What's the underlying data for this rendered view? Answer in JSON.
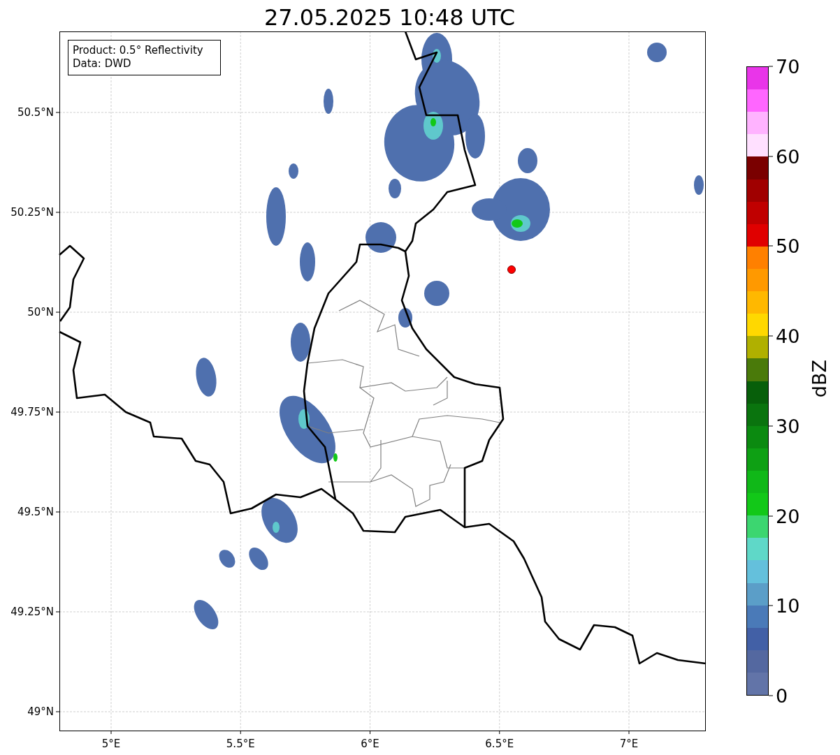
{
  "title": "27.05.2025 10:48 UTC",
  "legend": {
    "lines": [
      "Product: 0.5° Reflectivity",
      "Data: DWD"
    ]
  },
  "map": {
    "x_ticks": [
      "5°E",
      "5.5°E",
      "6°E",
      "6.5°E",
      "7°E"
    ],
    "y_ticks": [
      "50.5°N",
      "50.25°N",
      "50°N",
      "49.75°N",
      "49.5°N",
      "49.25°N",
      "49°N"
    ]
  },
  "colorbar": {
    "label": "dBZ",
    "ticks": [
      "70",
      "60",
      "50",
      "40",
      "30",
      "20",
      "10",
      "0"
    ],
    "bands": [
      {
        "color": "#e935e9"
      },
      {
        "color": "#ff66ff"
      },
      {
        "color": "#ffb3ff"
      },
      {
        "color": "#ffe0ff"
      },
      {
        "color": "#7a0000"
      },
      {
        "color": "#a00000"
      },
      {
        "color": "#c00000"
      },
      {
        "color": "#e00000"
      },
      {
        "color": "#ff8000"
      },
      {
        "color": "#ff9900"
      },
      {
        "color": "#ffb800"
      },
      {
        "color": "#ffd800"
      },
      {
        "color": "#b0b000"
      },
      {
        "color": "#4a7a0a"
      },
      {
        "color": "#075f0a"
      },
      {
        "color": "#0a740e"
      },
      {
        "color": "#0b8a10"
      },
      {
        "color": "#0ea014"
      },
      {
        "color": "#10b818"
      },
      {
        "color": "#12c818"
      },
      {
        "color": "#3cd670"
      },
      {
        "color": "#5fd8c8"
      },
      {
        "color": "#64c0dc"
      },
      {
        "color": "#5b9ec8"
      },
      {
        "color": "#4a7ab8"
      },
      {
        "color": "#4260a6"
      },
      {
        "color": "#5468a0"
      },
      {
        "color": "#6274a8"
      }
    ]
  }
}
